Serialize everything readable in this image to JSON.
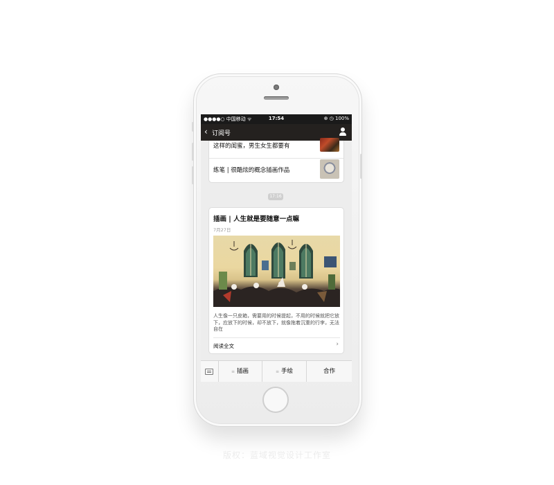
{
  "status_bar": {
    "carrier": "●●●●○ 中国移动 ᯤ",
    "time": "17:54",
    "right": "⊕ ◷ 100%"
  },
  "nav": {
    "back_icon": "chevron-left",
    "title": "订阅号",
    "user_icon": "person"
  },
  "articles_top": [
    {
      "title": "这样的闺蜜，男生女生都要有"
    },
    {
      "title": "练笔 | 很酷炫的概念插画作品"
    }
  ],
  "timestamp": "17:16",
  "article": {
    "title": "插画 | 人生就是要随意一点嘛",
    "date": "7月27日",
    "description": "人生像一只皮箱，需要用的时候提起，不用的时候就把它放下，应放下的时候，却不放下，就像拖着沉重的行李，无法自在",
    "read_more": "阅读全文"
  },
  "menu": {
    "keyboard_icon": "keyboard",
    "items": [
      {
        "label": "插画",
        "prefix": "≡"
      },
      {
        "label": "手绘",
        "prefix": "≡"
      },
      {
        "label": "合作"
      }
    ]
  },
  "caption": "版权：蓝域视觉设计工作室",
  "colors": {
    "nav_bg": "#24211f",
    "status_bg": "#1a1a1a",
    "chat_bg": "#ededed"
  }
}
